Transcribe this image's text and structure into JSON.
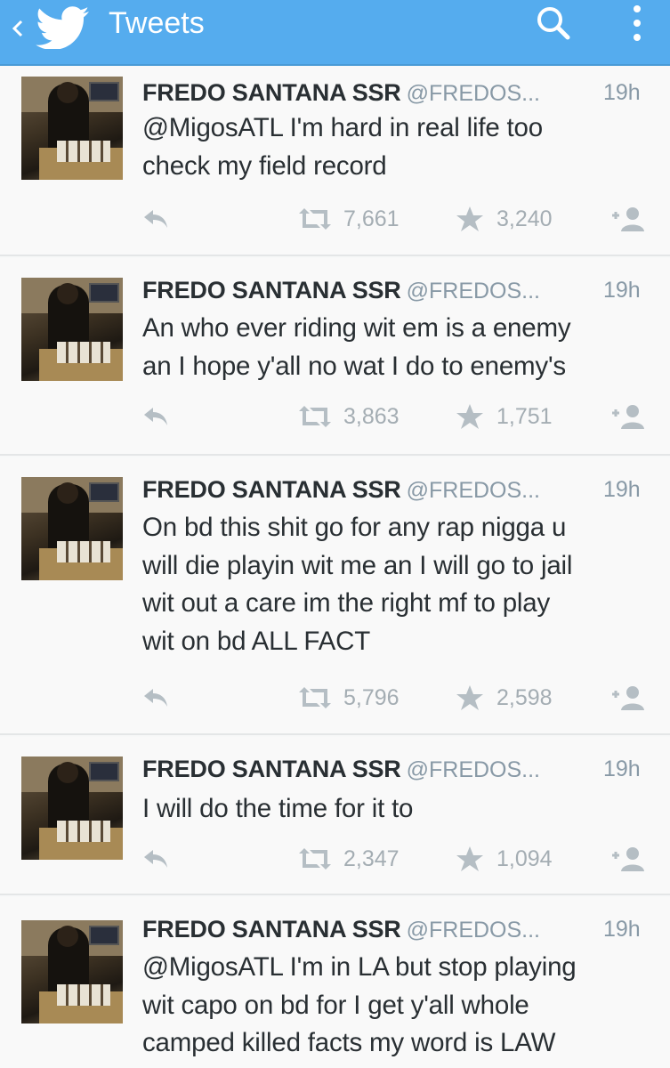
{
  "appbar": {
    "title": "Tweets",
    "icons": [
      "back-icon",
      "twitter-bird-icon",
      "search-icon",
      "more-vertical-icon"
    ],
    "color": "#55acee"
  },
  "tweets": [
    {
      "name": "FREDO SANTANA SSR",
      "handle": "@FREDOS...",
      "time": "19h",
      "lines": [
        "@MigosATL I'm hard in real life too",
        "check my field record"
      ],
      "retweets": "7,661",
      "favorites": "3,240"
    },
    {
      "name": "FREDO SANTANA SSR",
      "handle": "@FREDOS...",
      "time": "19h",
      "lines": [
        "An who ever riding wit em is a enemy",
        "an I hope y'all no wat I do to enemy's"
      ],
      "retweets": "3,863",
      "favorites": "1,751"
    },
    {
      "name": "FREDO SANTANA SSR",
      "handle": "@FREDOS...",
      "time": "19h",
      "lines": [
        "On bd this shit go for any rap nigga u",
        "will die playin wit me an I will go to jail",
        "wit out a care im the right mf to play",
        "wit on bd ALL FACT"
      ],
      "retweets": "5,796",
      "favorites": "2,598"
    },
    {
      "name": "FREDO SANTANA SSR",
      "handle": "@FREDOS...",
      "time": "19h",
      "lines": [
        "I will do the time for it to"
      ],
      "retweets": "2,347",
      "favorites": "1,094"
    },
    {
      "name": "FREDO SANTANA SSR",
      "handle": "@FREDOS...",
      "time": "19h",
      "lines": [
        "@MigosATL I'm in LA but stop playing",
        "wit capo on bd for I get y'all whole",
        "camped killed facts my word is LAW"
      ],
      "retweets": null,
      "favorites": null
    }
  ]
}
